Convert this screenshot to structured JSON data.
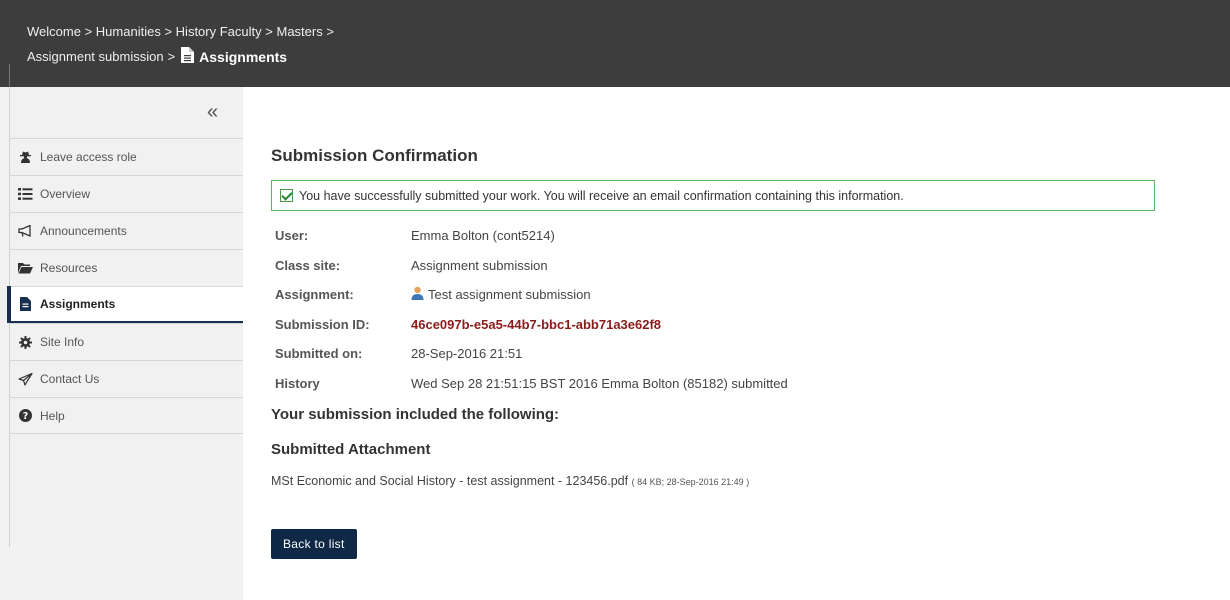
{
  "breadcrumb": {
    "items": [
      "Welcome",
      "Humanities",
      "History Faculty",
      "Masters"
    ],
    "parent": "Assignment submission",
    "current": "Assignments",
    "separator": ">"
  },
  "sidebar": {
    "collapse_label": "«",
    "items": [
      {
        "label": "Leave access role",
        "icon": "user-secret-icon"
      },
      {
        "label": "Overview",
        "icon": "list-icon"
      },
      {
        "label": "Announcements",
        "icon": "megaphone-icon"
      },
      {
        "label": "Resources",
        "icon": "folder-open-icon"
      },
      {
        "label": "Assignments",
        "icon": "file-icon",
        "active": true
      },
      {
        "label": "Site Info",
        "icon": "gear-icon"
      },
      {
        "label": "Contact Us",
        "icon": "paper-plane-icon"
      },
      {
        "label": "Help",
        "icon": "question-icon"
      }
    ]
  },
  "main": {
    "title": "Submission Confirmation",
    "alert": "You have successfully submitted your work. You will receive an email confirmation containing this information.",
    "fields": {
      "user_label": "User:",
      "user_value": "Emma Bolton (cont5214)",
      "class_label": "Class site:",
      "class_value": "Assignment submission",
      "assignment_label": "Assignment:",
      "assignment_value": "Test assignment submission",
      "submission_id_label": "Submission ID:",
      "submission_id_value": "46ce097b-e5a5-44b7-bbc1-abb71a3e62f8",
      "submitted_on_label": "Submitted on:",
      "submitted_on_value": "28-Sep-2016 21:51",
      "history_label": "History",
      "history_value": "Wed Sep 28 21:51:15 BST 2016 Emma Bolton (85182) submitted"
    },
    "included_heading": "Your submission included the following:",
    "attachment_heading": "Submitted Attachment",
    "attachment_name": "MSt Economic and Social History - test assignment - 123456.pdf",
    "attachment_meta": "( 84 KB; 28-Sep-2016 21:49 )",
    "back_button": "Back to list"
  },
  "colors": {
    "header_bg": "#3d3d3d",
    "sidebar_bg": "#f1f1f1",
    "accent": "#0e2846",
    "success_border": "#5cb85c",
    "submission_id": "#8b1a1a"
  }
}
